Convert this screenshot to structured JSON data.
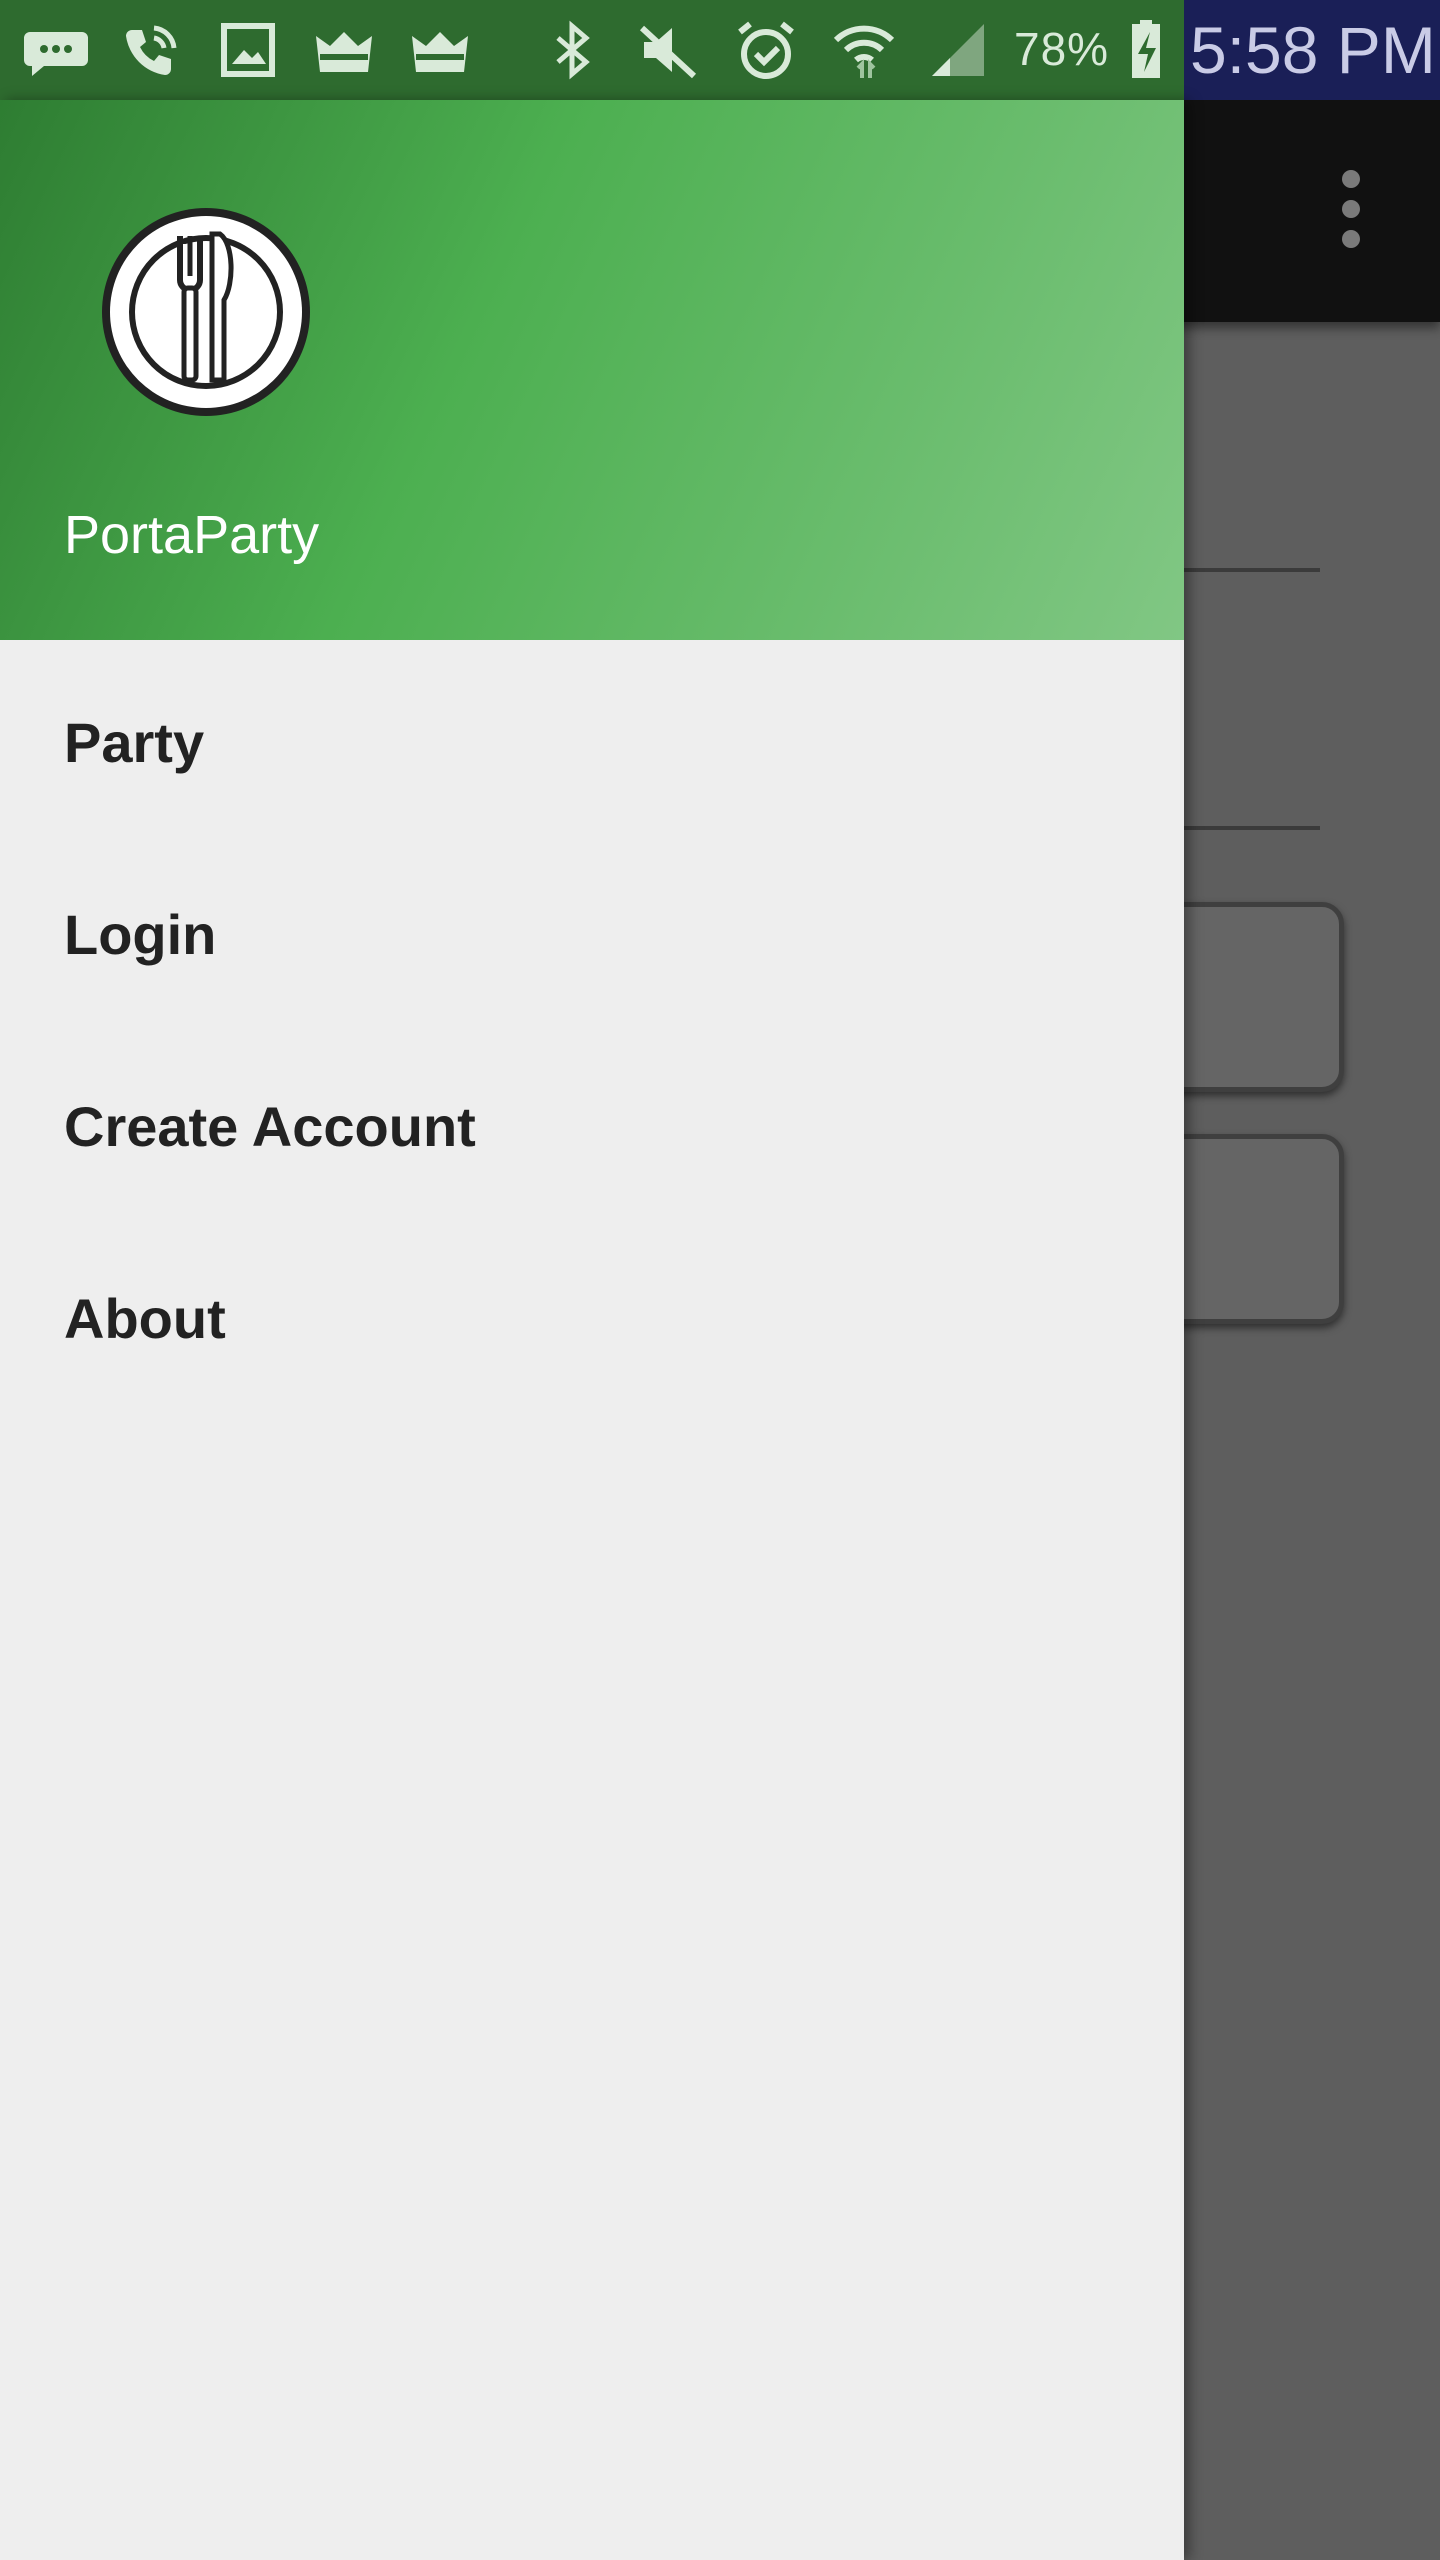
{
  "status_bar": {
    "icons": [
      "message-notification-icon",
      "wifi-calling-icon",
      "gallery-icon",
      "crown-app-icon",
      "crown-app-icon",
      "bluetooth-icon",
      "mute-icon",
      "alarm-icon",
      "wifi-icon",
      "signal-icon",
      "battery-charging-icon"
    ],
    "battery": "78%",
    "time": "5:58 PM"
  },
  "drawer": {
    "app_name": "PortaParty",
    "logo_icon": "plate-fork-knife-icon",
    "items": [
      {
        "label": "Party"
      },
      {
        "label": "Login"
      },
      {
        "label": "Create Account"
      },
      {
        "label": "About"
      }
    ]
  },
  "background_app": {
    "overflow_icon": "more-vert-icon"
  },
  "colors": {
    "header_start": "#2e7d32",
    "header_mid": "#4caf50",
    "header_end": "#81c784",
    "drawer_bg": "#eeeeee",
    "toolbar_bg": "#111111",
    "scrim": "#5e5e5e",
    "status_bar_green": "#2e6b2f",
    "status_bar_navy": "#1a1f57"
  }
}
